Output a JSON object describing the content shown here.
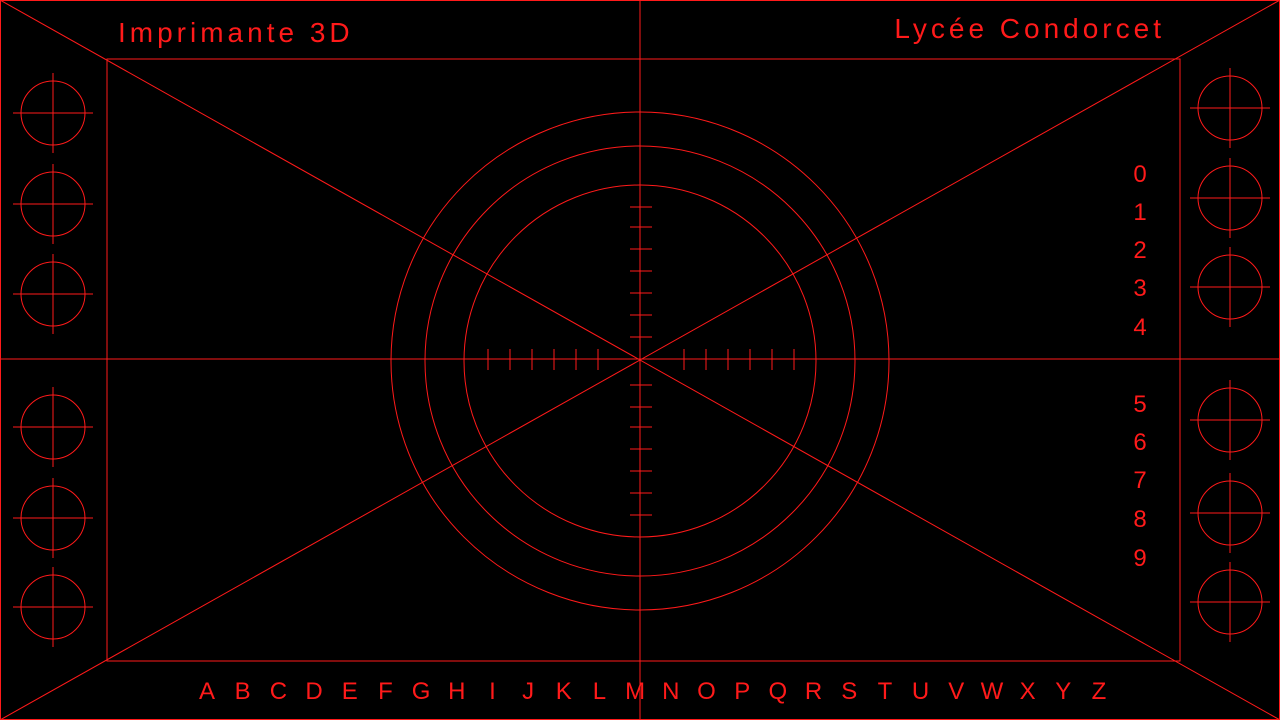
{
  "header": {
    "left_title": "Imprimante 3D",
    "right_title": "Lycée Condorcet"
  },
  "digits": [
    "0",
    "1",
    "2",
    "3",
    "4",
    "5",
    "6",
    "7",
    "8",
    "9"
  ],
  "letters": [
    "A",
    "B",
    "C",
    "D",
    "E",
    "F",
    "G",
    "H",
    "I",
    "J",
    "K",
    "L",
    "M",
    "N",
    "O",
    "P",
    "Q",
    "R",
    "S",
    "T",
    "U",
    "V",
    "W",
    "X",
    "Y",
    "Z"
  ],
  "colors": {
    "line": "#ff1a1a",
    "background": "#000000"
  },
  "markers": {
    "left_icon": "crosshair-circle-icon",
    "right_icon": "crosshair-circle-icon"
  }
}
